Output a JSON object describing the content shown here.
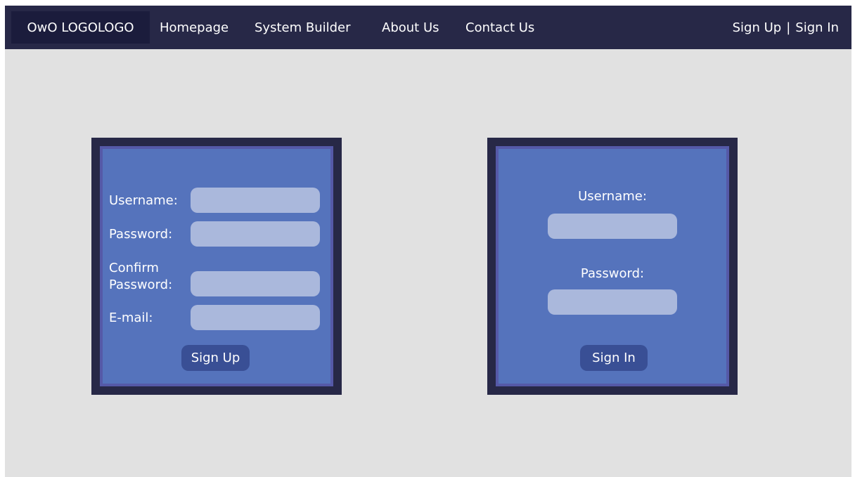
{
  "nav": {
    "logo": "OwO LOGOLOGO",
    "links": [
      "Homepage",
      "System Builder",
      "About Us",
      "Contact Us"
    ],
    "sign_up": "Sign Up",
    "separator": "|",
    "sign_in": "Sign In"
  },
  "signup_form": {
    "username_label": "Username:",
    "password_label": "Password:",
    "confirm_label_line1": "Confirm",
    "confirm_label_line2": "Password:",
    "email_label": "E-mail:",
    "submit_label": "Sign Up"
  },
  "signin_form": {
    "username_label": "Username:",
    "password_label": "Password:",
    "submit_label": "Sign In"
  },
  "colors": {
    "navbar": "#272847",
    "logo_bg": "#1b1c3c",
    "page_bg": "#e1e1e1",
    "panel_border": "#272847",
    "panel_fill": "#5573bc",
    "input_fill": "#aab8dc",
    "button_fill": "#394f95"
  }
}
